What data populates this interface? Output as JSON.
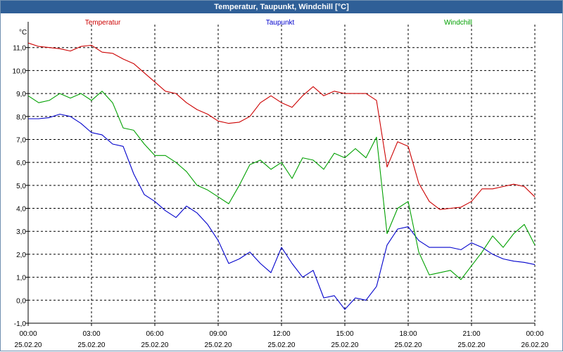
{
  "window": {
    "title": "Temperatur, Taupunkt, Windchill [°C]"
  },
  "chart_data": {
    "type": "line",
    "title": "Temperatur, Taupunkt, Windchill [°C]",
    "ylabel": "°C",
    "ylim": [
      -1.0,
      12.0
    ],
    "y_ticks": [
      "-1,0",
      "0,0",
      "1,0",
      "2,0",
      "3,0",
      "4,0",
      "5,0",
      "6,0",
      "7,0",
      "8,0",
      "9,0",
      "10,0",
      "11,0"
    ],
    "x_ticks": [
      {
        "time": "00:00",
        "date": "25.02.20"
      },
      {
        "time": "03:00",
        "date": "25.02.20"
      },
      {
        "time": "06:00",
        "date": "25.02.20"
      },
      {
        "time": "09:00",
        "date": "25.02.20"
      },
      {
        "time": "12:00",
        "date": "25.02.20"
      },
      {
        "time": "15:00",
        "date": "25.02.20"
      },
      {
        "time": "18:00",
        "date": "25.02.20"
      },
      {
        "time": "21:00",
        "date": "25.02.20"
      },
      {
        "time": "00:00",
        "date": "26.02.20"
      }
    ],
    "xlim": [
      0,
      24
    ],
    "grid": true,
    "legend_position": "top",
    "series": [
      {
        "name": "Temperatur",
        "color": "#cc0000",
        "points": [
          [
            0,
            11.2
          ],
          [
            0.5,
            11.05
          ],
          [
            1,
            11.0
          ],
          [
            1.5,
            10.95
          ],
          [
            2,
            10.85
          ],
          [
            2.5,
            11.05
          ],
          [
            3,
            11.1
          ],
          [
            3.5,
            10.8
          ],
          [
            4,
            10.75
          ],
          [
            4.5,
            10.5
          ],
          [
            5,
            10.3
          ],
          [
            5.5,
            9.9
          ],
          [
            6,
            9.5
          ],
          [
            6.5,
            9.1
          ],
          [
            7,
            9.0
          ],
          [
            7.5,
            8.6
          ],
          [
            8,
            8.3
          ],
          [
            8.5,
            8.1
          ],
          [
            9,
            7.8
          ],
          [
            9.5,
            7.7
          ],
          [
            10,
            7.75
          ],
          [
            10.5,
            8.0
          ],
          [
            11,
            8.6
          ],
          [
            11.5,
            8.9
          ],
          [
            12,
            8.6
          ],
          [
            12.5,
            8.4
          ],
          [
            13,
            8.9
          ],
          [
            13.5,
            9.3
          ],
          [
            14,
            8.9
          ],
          [
            14.5,
            9.1
          ],
          [
            15,
            9.0
          ],
          [
            15.5,
            9.0
          ],
          [
            16,
            9.0
          ],
          [
            16.5,
            8.7
          ],
          [
            17,
            5.8
          ],
          [
            17.5,
            6.9
          ],
          [
            18,
            6.7
          ],
          [
            18.5,
            5.1
          ],
          [
            19,
            4.3
          ],
          [
            19.5,
            3.95
          ],
          [
            20,
            4.0
          ],
          [
            20.5,
            4.05
          ],
          [
            21,
            4.3
          ],
          [
            21.5,
            4.85
          ],
          [
            22,
            4.85
          ],
          [
            22.5,
            4.95
          ],
          [
            23,
            5.05
          ],
          [
            23.5,
            4.95
          ],
          [
            24,
            4.5
          ]
        ]
      },
      {
        "name": "Taupunkt",
        "color": "#0000cc",
        "points": [
          [
            0,
            7.9
          ],
          [
            0.5,
            7.9
          ],
          [
            1,
            7.95
          ],
          [
            1.5,
            8.1
          ],
          [
            2,
            8.0
          ],
          [
            2.5,
            7.7
          ],
          [
            3,
            7.3
          ],
          [
            3.5,
            7.2
          ],
          [
            4,
            6.8
          ],
          [
            4.5,
            6.7
          ],
          [
            5,
            5.5
          ],
          [
            5.5,
            4.6
          ],
          [
            6,
            4.3
          ],
          [
            6.5,
            3.9
          ],
          [
            7,
            3.6
          ],
          [
            7.5,
            4.1
          ],
          [
            8,
            3.8
          ],
          [
            8.5,
            3.3
          ],
          [
            9,
            2.6
          ],
          [
            9.5,
            1.6
          ],
          [
            10,
            1.8
          ],
          [
            10.5,
            2.1
          ],
          [
            11,
            1.6
          ],
          [
            11.5,
            1.2
          ],
          [
            12,
            2.3
          ],
          [
            12.5,
            1.6
          ],
          [
            13,
            1.0
          ],
          [
            13.5,
            1.3
          ],
          [
            14,
            0.1
          ],
          [
            14.5,
            0.2
          ],
          [
            15,
            -0.4
          ],
          [
            15.5,
            0.1
          ],
          [
            16,
            0.0
          ],
          [
            16.5,
            0.6
          ],
          [
            17,
            2.4
          ],
          [
            17.5,
            3.1
          ],
          [
            18,
            3.2
          ],
          [
            18.5,
            2.6
          ],
          [
            19,
            2.3
          ],
          [
            19.5,
            2.3
          ],
          [
            20,
            2.3
          ],
          [
            20.5,
            2.2
          ],
          [
            21,
            2.5
          ],
          [
            21.5,
            2.3
          ],
          [
            22,
            2.0
          ],
          [
            22.5,
            1.8
          ],
          [
            23,
            1.7
          ],
          [
            23.5,
            1.65
          ],
          [
            24,
            1.55
          ]
        ]
      },
      {
        "name": "Windchill",
        "color": "#00a000",
        "points": [
          [
            0,
            8.9
          ],
          [
            0.5,
            8.6
          ],
          [
            1,
            8.7
          ],
          [
            1.5,
            9.0
          ],
          [
            2,
            8.8
          ],
          [
            2.5,
            9.0
          ],
          [
            3,
            8.7
          ],
          [
            3.5,
            9.1
          ],
          [
            4,
            8.6
          ],
          [
            4.5,
            7.5
          ],
          [
            5,
            7.4
          ],
          [
            5.5,
            6.8
          ],
          [
            6,
            6.3
          ],
          [
            6.5,
            6.3
          ],
          [
            7,
            6.0
          ],
          [
            7.5,
            5.6
          ],
          [
            8,
            5.0
          ],
          [
            8.5,
            4.8
          ],
          [
            9,
            4.5
          ],
          [
            9.5,
            4.2
          ],
          [
            10,
            5.0
          ],
          [
            10.5,
            5.9
          ],
          [
            11,
            6.1
          ],
          [
            11.5,
            5.7
          ],
          [
            12,
            6.0
          ],
          [
            12.5,
            5.3
          ],
          [
            13,
            6.2
          ],
          [
            13.5,
            6.1
          ],
          [
            14,
            5.7
          ],
          [
            14.5,
            6.4
          ],
          [
            15,
            6.2
          ],
          [
            15.5,
            6.6
          ],
          [
            16,
            6.2
          ],
          [
            16.5,
            7.1
          ],
          [
            17,
            2.9
          ],
          [
            17.5,
            4.0
          ],
          [
            18,
            4.3
          ],
          [
            18.5,
            2.1
          ],
          [
            19,
            1.1
          ],
          [
            19.5,
            1.2
          ],
          [
            20,
            1.3
          ],
          [
            20.5,
            0.9
          ],
          [
            21,
            1.5
          ],
          [
            21.5,
            2.1
          ],
          [
            22,
            2.8
          ],
          [
            22.5,
            2.3
          ],
          [
            23,
            2.9
          ],
          [
            23.5,
            3.3
          ],
          [
            24,
            2.4
          ]
        ]
      }
    ]
  }
}
